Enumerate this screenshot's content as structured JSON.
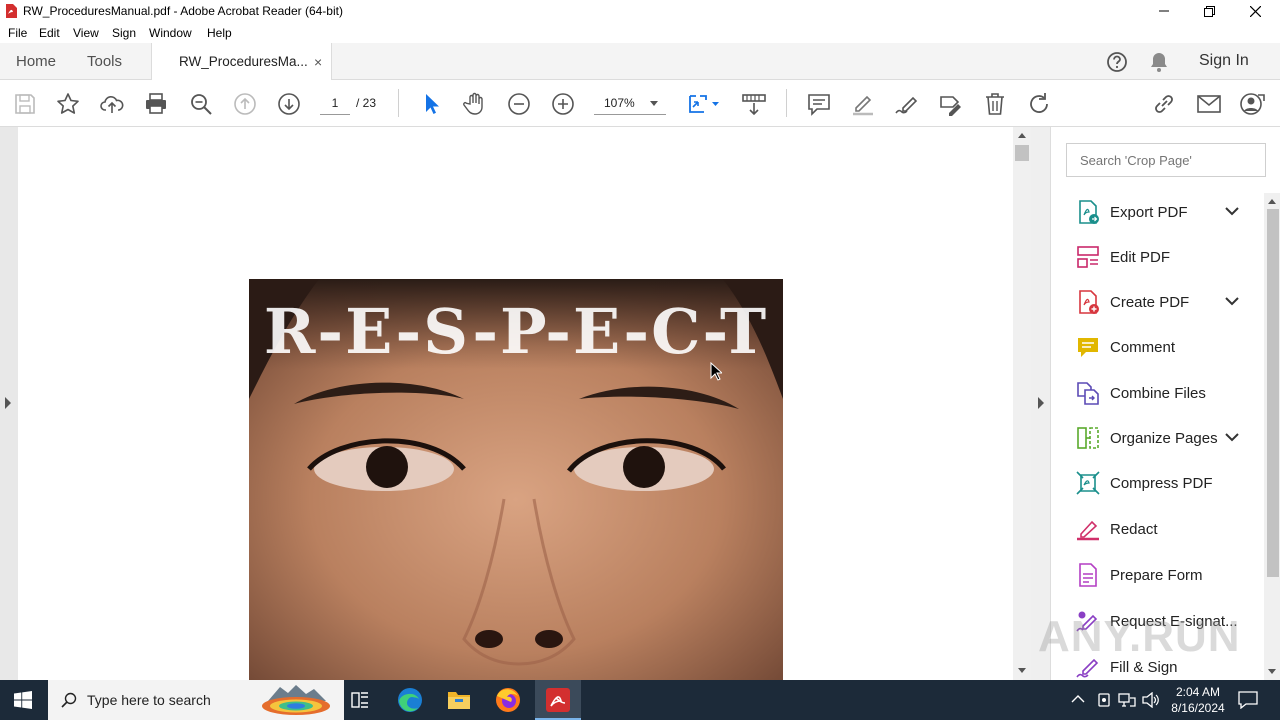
{
  "window": {
    "title": "RW_ProceduresManual.pdf - Adobe Acrobat Reader (64-bit)"
  },
  "menu": [
    "File",
    "Edit",
    "View",
    "Sign",
    "Window",
    "Help"
  ],
  "tabs": {
    "home": "Home",
    "tools": "Tools",
    "document": "RW_ProceduresMa...",
    "close": "×",
    "sign_in": "Sign In"
  },
  "toolbar": {
    "current_page": "1",
    "page_total": "/  23",
    "zoom": "107%"
  },
  "document": {
    "heading_text": "R-E-S-P-E-C-T"
  },
  "panel": {
    "search_placeholder": "Search 'Crop Page'",
    "tools": [
      {
        "label": "Export PDF",
        "icon": "export-pdf-icon",
        "color": "#1a8f8c",
        "expandable": true
      },
      {
        "label": "Edit PDF",
        "icon": "edit-pdf-icon",
        "color": "#c9286a",
        "expandable": false
      },
      {
        "label": "Create PDF",
        "icon": "create-pdf-icon",
        "color": "#d7373f",
        "expandable": true
      },
      {
        "label": "Comment",
        "icon": "comment-icon",
        "color": "#e1b700",
        "expandable": false
      },
      {
        "label": "Combine Files",
        "icon": "combine-files-icon",
        "color": "#5c4bb5",
        "expandable": false
      },
      {
        "label": "Organize Pages",
        "icon": "organize-pages-icon",
        "color": "#5aaa2c",
        "expandable": true
      },
      {
        "label": "Compress PDF",
        "icon": "compress-pdf-icon",
        "color": "#1a8f8c",
        "expandable": false
      },
      {
        "label": "Redact",
        "icon": "redact-icon",
        "color": "#d0306a",
        "expandable": false
      },
      {
        "label": "Prepare Form",
        "icon": "prepare-form-icon",
        "color": "#b43fc4",
        "expandable": false
      },
      {
        "label": "Request E-signat...",
        "icon": "request-esign-icon",
        "color": "#8a3fc4",
        "expandable": false
      },
      {
        "label": "Fill & Sign",
        "icon": "fill-sign-icon",
        "color": "#8a3fc4",
        "expandable": false
      }
    ]
  },
  "taskbar": {
    "search_placeholder": "Type here to search",
    "time": "2:04 AM",
    "date": "8/16/2024"
  },
  "watermark": "ANY.RUN"
}
